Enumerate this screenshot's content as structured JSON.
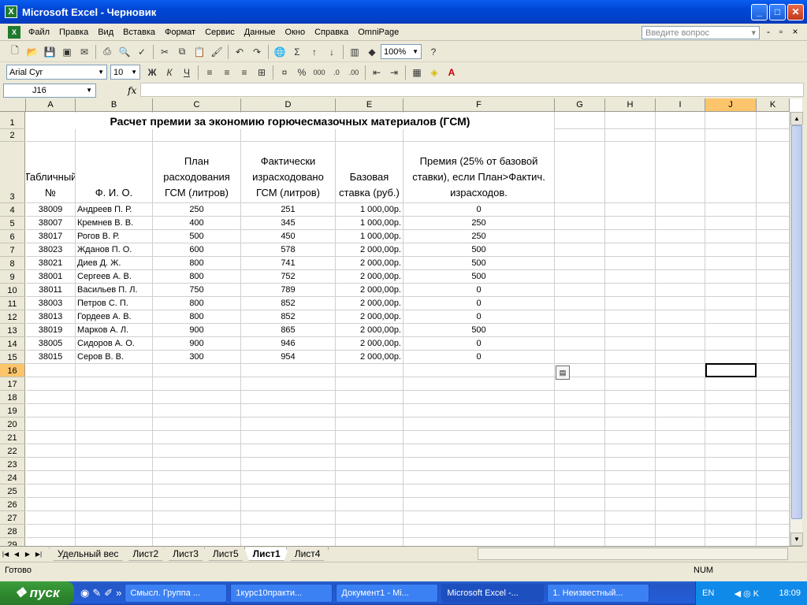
{
  "window": {
    "title": "Microsoft Excel - Черновик",
    "app_icon": "X"
  },
  "menu": {
    "items": [
      "Файл",
      "Правка",
      "Вид",
      "Вставка",
      "Формат",
      "Сервис",
      "Данные",
      "Окно",
      "Справка",
      "OmniPage"
    ],
    "ask_placeholder": "Введите вопрос"
  },
  "toolbar": {
    "zoom": "100%",
    "font": "Arial Cyr",
    "size": "10",
    "bold": "Ж",
    "italic": "К",
    "underline": "Ч"
  },
  "formula_bar": {
    "cell_ref": "J16",
    "fx": "fx",
    "value": ""
  },
  "columns": [
    "A",
    "B",
    "C",
    "D",
    "E",
    "F",
    "G",
    "H",
    "I",
    "J",
    "K"
  ],
  "sheet": {
    "title": "Расчет премии за экономию горючесмазочных материалов (ГСМ)",
    "headers": [
      "Табличный №",
      "Ф. И. О.",
      "План расходования ГСМ (литров)",
      "Фактически израсходовано ГСМ (литров)",
      "Базовая ставка (руб.)",
      "Премия (25% от базовой ставки), если План>Фактич. израсходов."
    ],
    "rows": [
      [
        "38009",
        "Андреев П. Р.",
        "250",
        "251",
        "1 000,00р.",
        "0"
      ],
      [
        "38007",
        "Кремнев В. В.",
        "400",
        "345",
        "1 000,00р.",
        "250"
      ],
      [
        "38017",
        "Рогов В. Р.",
        "500",
        "450",
        "1 000,00р.",
        "250"
      ],
      [
        "38023",
        "Жданов П. О.",
        "600",
        "578",
        "2 000,00р.",
        "500"
      ],
      [
        "38021",
        "Диев Д. Ж.",
        "800",
        "741",
        "2 000,00р.",
        "500"
      ],
      [
        "38001",
        "Сергеев А. В.",
        "800",
        "752",
        "2 000,00р.",
        "500"
      ],
      [
        "38011",
        "Васильев П. Л.",
        "750",
        "789",
        "2 000,00р.",
        "0"
      ],
      [
        "38003",
        "Петров С. П.",
        "800",
        "852",
        "2 000,00р.",
        "0"
      ],
      [
        "38013",
        "Гордеев А. В.",
        "800",
        "852",
        "2 000,00р.",
        "0"
      ],
      [
        "38019",
        "Марков А. Л.",
        "900",
        "865",
        "2 000,00р.",
        "500"
      ],
      [
        "38005",
        "Сидоров А. О.",
        "900",
        "946",
        "2 000,00р.",
        "0"
      ],
      [
        "38015",
        "Серов В. В.",
        "300",
        "954",
        "2 000,00р.",
        "0"
      ]
    ],
    "row_numbers": [
      "1",
      "2",
      "3",
      "4",
      "5",
      "6",
      "7",
      "8",
      "9",
      "10",
      "11",
      "12",
      "13",
      "14",
      "15",
      "16",
      "17",
      "18",
      "19",
      "20",
      "21",
      "22",
      "23",
      "24",
      "25",
      "26",
      "27",
      "28",
      "29"
    ]
  },
  "sheet_tabs": [
    "Удельный вес",
    "Лист2",
    "Лист3",
    "Лист5",
    "Лист1",
    "Лист4"
  ],
  "active_tab": "Лист1",
  "status": {
    "left": "Готово",
    "num": "NUM"
  },
  "taskbar": {
    "start": "пуск",
    "tasks": [
      "Смысл. Группа ...",
      "1курс10практи...",
      "Документ1 - Mi...",
      "Microsoft Excel -...",
      "1. Неизвестный..."
    ],
    "lang": "EN",
    "clock": "18:09"
  },
  "colors": {
    "titlebar": "#0046d5",
    "selection": "#fcc56b",
    "start": "#2f8a2f"
  }
}
